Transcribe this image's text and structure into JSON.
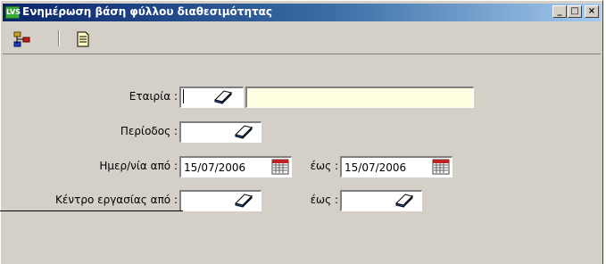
{
  "window": {
    "title": "Ενημέρωση βάση φύλλου διαθεσιμότητας",
    "icon_label": "LVS",
    "buttons": {
      "minimize": "_",
      "maximize": "□",
      "close": "×"
    }
  },
  "toolbar": {
    "items": [
      {
        "name": "tree-icon"
      },
      {
        "name": "document-icon"
      }
    ]
  },
  "form": {
    "company": {
      "label": "Εταιρία :",
      "code": "",
      "name": ""
    },
    "period": {
      "label": "Περίοδος :",
      "value": ""
    },
    "date_from": {
      "label": "Ημερ/νία από :",
      "value": "15/07/2006"
    },
    "date_to": {
      "label": "έως :",
      "value": "15/07/2006"
    },
    "work_center_from": {
      "label": "Κέντρο εργασίας από :",
      "value": ""
    },
    "work_center_to": {
      "label": "έως :",
      "value": ""
    }
  },
  "colors": {
    "window_bg": "#d4d0c8",
    "title_start": "#0a246a",
    "title_end": "#a6caf0",
    "highlight_field": "#ffffe1"
  }
}
